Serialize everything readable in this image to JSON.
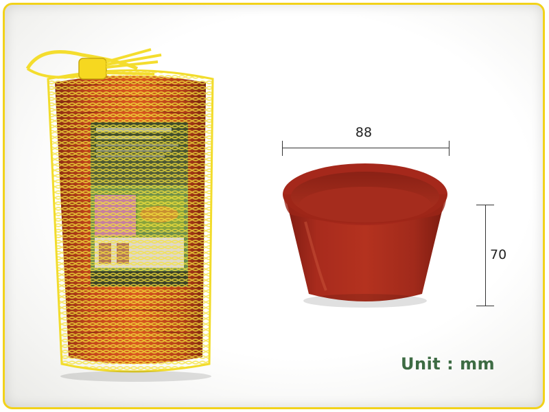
{
  "dimensions": {
    "width_label": "88",
    "height_label": "70"
  },
  "unit_label": "Unit : mm",
  "colors": {
    "frame_border": "#f2d21a",
    "pot": "#a2291c",
    "mesh": "#f5e23a",
    "unit_text": "#3d6b43"
  }
}
